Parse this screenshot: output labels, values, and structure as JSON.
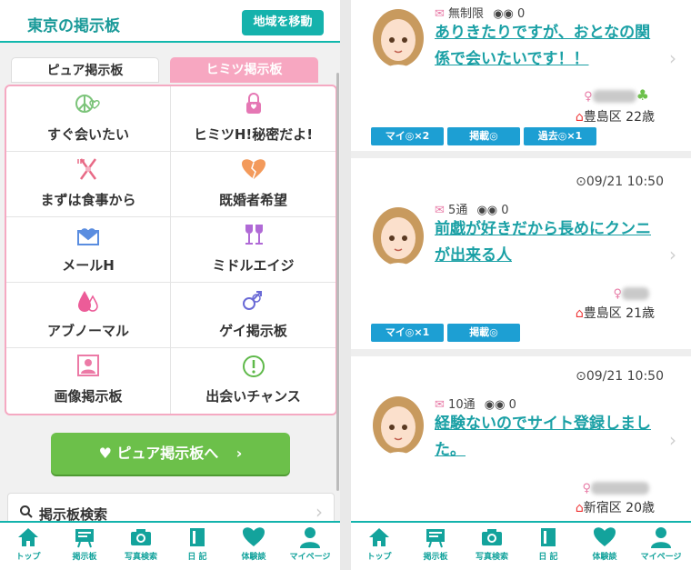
{
  "left": {
    "header_title": "東京の掲示板",
    "region_button": "地域を移動",
    "tabs": [
      "ピュア掲示板",
      "ヒミツ掲示板"
    ],
    "categories": [
      {
        "label": "すぐ会いたい",
        "icon": "peace-heart-icon"
      },
      {
        "label": "ヒミツH!秘密だよ!",
        "icon": "lock-icon"
      },
      {
        "label": "まずは食事から",
        "icon": "fork-knife-icon"
      },
      {
        "label": "既婚者希望",
        "icon": "broken-heart-icon"
      },
      {
        "label": "メールH",
        "icon": "heart-mail-icon"
      },
      {
        "label": "ミドルエイジ",
        "icon": "wine-glass-icon"
      },
      {
        "label": "アブノーマル",
        "icon": "drops-icon"
      },
      {
        "label": "ゲイ掲示板",
        "icon": "male-symbol-icon"
      },
      {
        "label": "画像掲示板",
        "icon": "picture-icon"
      },
      {
        "label": "出会いチャンス",
        "icon": "exclamation-icon"
      }
    ],
    "pure_button": "ピュア掲示板へ",
    "search_label": "掲示板検索"
  },
  "nav": [
    "トップ",
    "掲示板",
    "写真検索",
    "日 記",
    "体験談",
    "マイページ"
  ],
  "posts": [
    {
      "limit": "無制限",
      "views": "0",
      "title": "ありきたりですが、おとなの関係で会いたいです！！",
      "location": "豊島区 22歳",
      "badges": [
        "マイ◎×2",
        "掲載◎",
        "過去◎×1"
      ]
    },
    {
      "time": "09/21 10:50",
      "limit": "5通",
      "views": "0",
      "title": "前戯が好きだから長めにクンニが出来る人",
      "location": "豊島区 21歳",
      "badges": [
        "マイ◎×1",
        "掲載◎"
      ]
    },
    {
      "time": "09/21 10:50",
      "limit": "10通",
      "views": "0",
      "title": "経験ないのでサイト登録しました。",
      "location": "新宿区 20歳"
    }
  ],
  "colors": {
    "teal": "#15b2ac",
    "pink": "#f7a7c1",
    "green": "#6cc04a",
    "link": "#1aa0a5",
    "badge": "#1d9fd3"
  }
}
